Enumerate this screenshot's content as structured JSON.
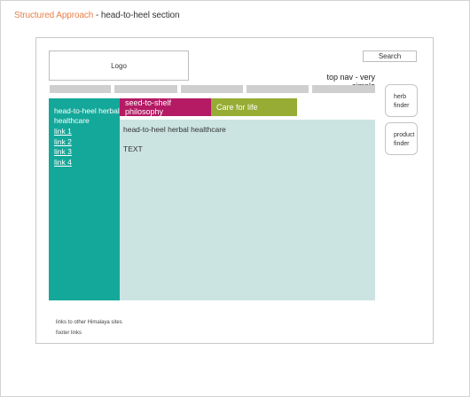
{
  "doc_title": {
    "accent": "Structured Approach",
    "rest": " - head-to-heel section"
  },
  "header": {
    "logo_label": "Logo",
    "search_label": "Search",
    "topnav_label": "top nav - very simple"
  },
  "side_buttons": {
    "herb": "herb finder",
    "product": "product finder"
  },
  "left_nav": {
    "title": "head-to-heel herbal healthcare",
    "links": [
      "link 1",
      "link 2",
      "link 3",
      "link 4"
    ]
  },
  "tabs": [
    {
      "label": "seed-to-shelf philosophy",
      "color": "#b51a65"
    },
    {
      "label": "Care for life",
      "color": "#96ac34"
    }
  ],
  "content": {
    "title": "head-to-heel herbal healthcare",
    "body": "TEXT"
  },
  "footer": {
    "line1": "links to other Himalaya sites",
    "line2": "footer links"
  },
  "colors": {
    "accent_orange": "#e8804a",
    "teal": "#14a89a",
    "content_bg": "#cbe4e2",
    "magenta": "#b51a65",
    "olive": "#96ac34",
    "nav_gray": "#cfcfcf"
  }
}
